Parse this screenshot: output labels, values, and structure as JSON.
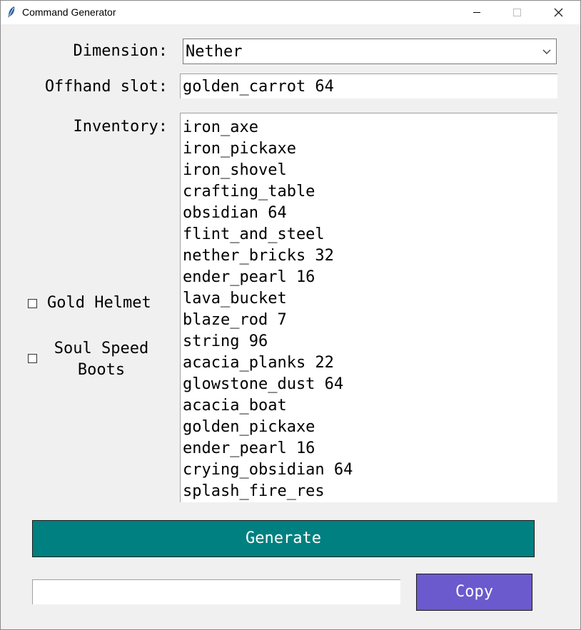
{
  "window": {
    "title": "Command Generator",
    "icon": "feather-icon"
  },
  "form": {
    "dimension_label": "Dimension:",
    "dimension_value": "Nether",
    "offhand_label": "Offhand slot:",
    "offhand_value": "golden_carrot 64",
    "inventory_label": "Inventory:",
    "inventory_items": [
      "iron_axe",
      "iron_pickaxe",
      "iron_shovel",
      "crafting_table",
      "obsidian 64",
      "flint_and_steel",
      "nether_bricks 32",
      "ender_pearl 16",
      "lava_bucket",
      "blaze_rod 7",
      "string 96",
      "acacia_planks 22",
      "glowstone_dust 64",
      "acacia_boat",
      "golden_pickaxe",
      "ender_pearl 16",
      "crying_obsidian 64",
      "splash_fire_res"
    ],
    "gold_helmet_label": "Gold Helmet",
    "gold_helmet_checked": false,
    "soul_speed_label_line1": "Soul Speed",
    "soul_speed_label_line2": "Boots",
    "soul_speed_checked": false
  },
  "actions": {
    "generate_label": "Generate",
    "output_value": "",
    "copy_label": "Copy"
  },
  "colors": {
    "generate_bg": "#008080",
    "copy_bg": "#6a5acd",
    "window_bg": "#f0f0f0"
  }
}
